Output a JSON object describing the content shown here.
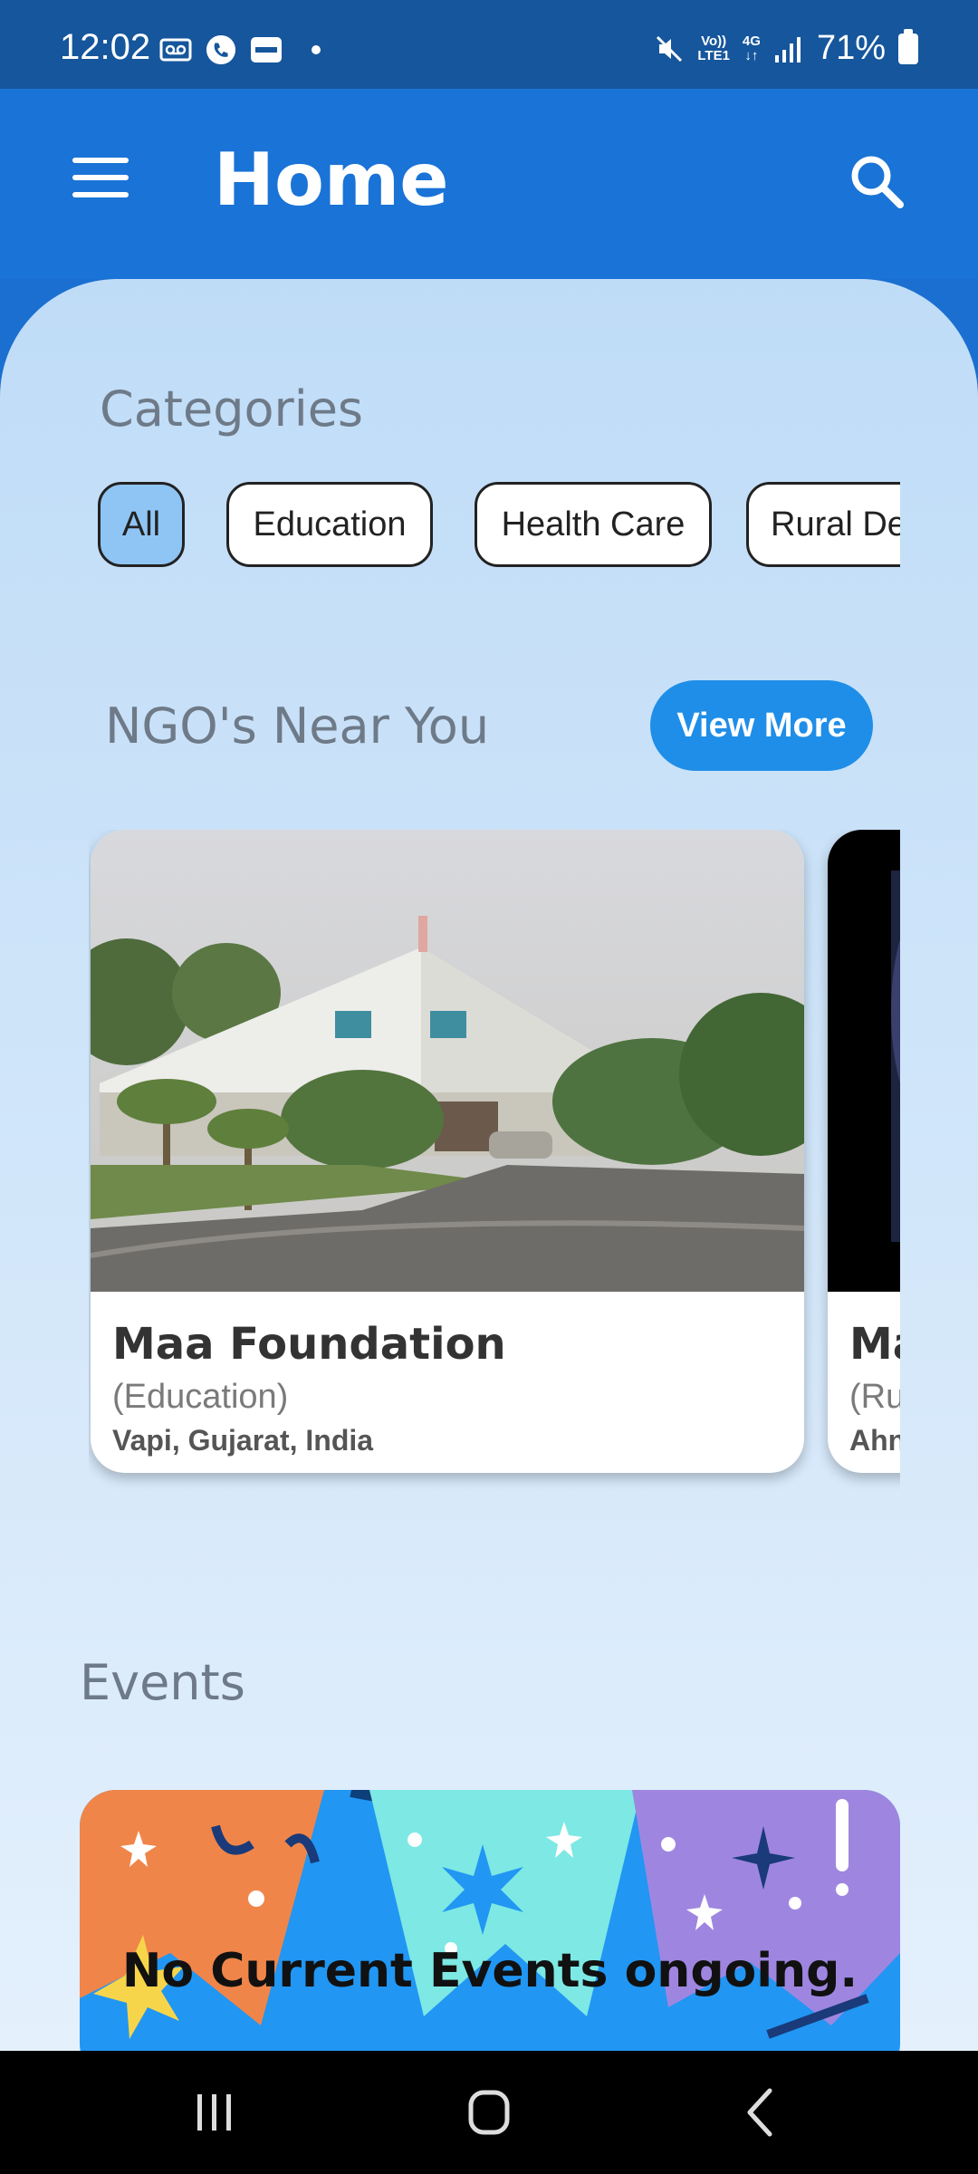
{
  "status": {
    "time": "12:02",
    "net_top": "Vo))",
    "net_bottom": "LTE1",
    "net2_top": "4G",
    "net2_bottom": "↓↑",
    "battery": "71%"
  },
  "header": {
    "title": "Home"
  },
  "categories": {
    "title": "Categories",
    "items": [
      "All",
      "Education",
      "Health Care",
      "Rural De"
    ],
    "active": "All"
  },
  "ngos": {
    "title": "NGO's Near You",
    "view_more": "View More",
    "cards": [
      {
        "name": "Maa Foundation",
        "category": "(Education)",
        "location": "Vapi, Gujarat, India"
      },
      {
        "name": "Ma",
        "category": "(Ru",
        "location": "Ahn"
      }
    ]
  },
  "events": {
    "title": "Events",
    "message": "No Current Events ongoing."
  },
  "colors": {
    "appbar": "#1a73d6",
    "statusbar": "#16569c",
    "accent": "#1f8ee8",
    "chip_active": "#8fc5f4"
  },
  "icons": [
    "menu-icon",
    "search-icon",
    "recents-icon",
    "home-icon",
    "back-icon"
  ]
}
